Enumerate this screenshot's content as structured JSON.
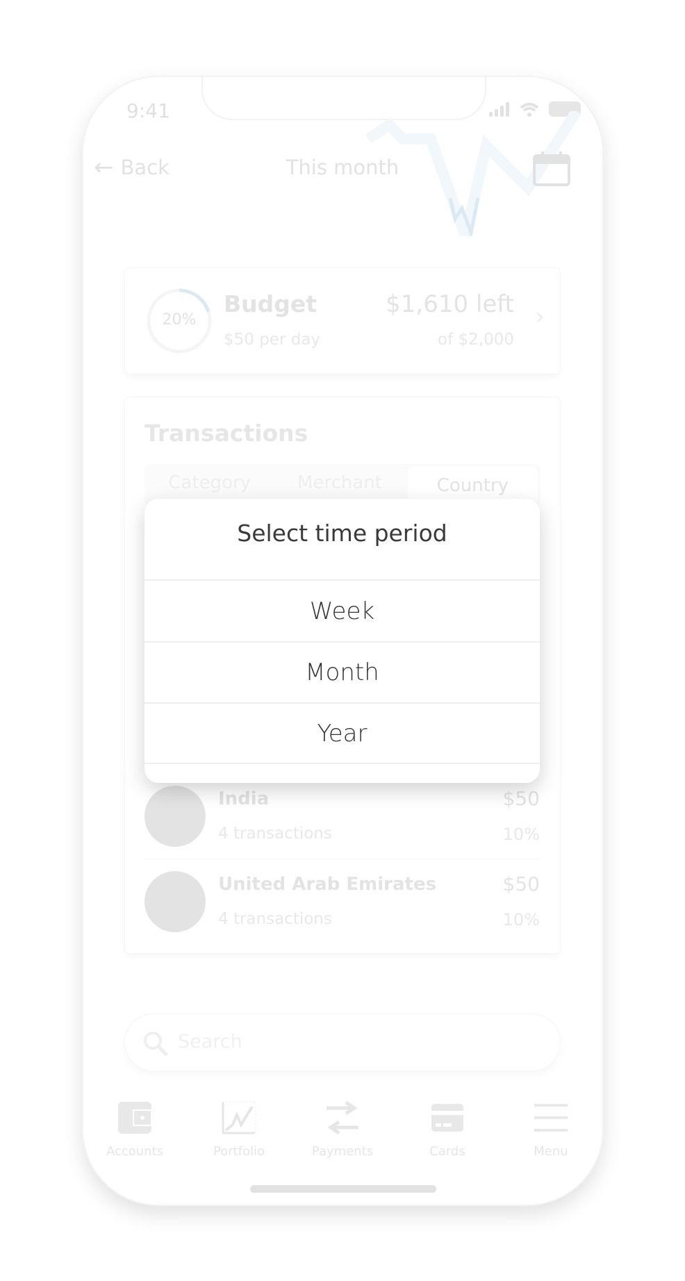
{
  "status_bar": {
    "time": "9:41"
  },
  "header": {
    "back_label": "Back",
    "title": "This month"
  },
  "budget": {
    "percent_label": "20%",
    "percent": 20,
    "title": "Budget",
    "per_day": "$50 per day",
    "left": "$1,610 left",
    "total": "of $2,000"
  },
  "transactions": {
    "title": "Transactions",
    "segments": [
      "Category",
      "Merchant",
      "Country"
    ],
    "selected_segment": "Country",
    "rows": [
      {
        "name": "India",
        "sub": "4 transactions",
        "amount": "$50",
        "percent": "10%"
      },
      {
        "name": "United Arab Emirates",
        "sub": "4 transactions",
        "amount": "$50",
        "percent": "10%"
      }
    ]
  },
  "search": {
    "placeholder": "Search"
  },
  "tabbar": [
    {
      "label": "Accounts",
      "icon": "wallet-icon"
    },
    {
      "label": "Portfolio",
      "icon": "chart-icon"
    },
    {
      "label": "Payments",
      "icon": "transfer-icon"
    },
    {
      "label": "Cards",
      "icon": "card-icon"
    },
    {
      "label": "Menu",
      "icon": "menu-icon"
    }
  ],
  "dialog": {
    "title": "Select time period",
    "options": [
      "Week",
      "Month",
      "Year"
    ]
  },
  "colors": {
    "accent": "#dbe9f3",
    "faded_text": "#e2e2e2",
    "dialog_text": "#333333"
  }
}
